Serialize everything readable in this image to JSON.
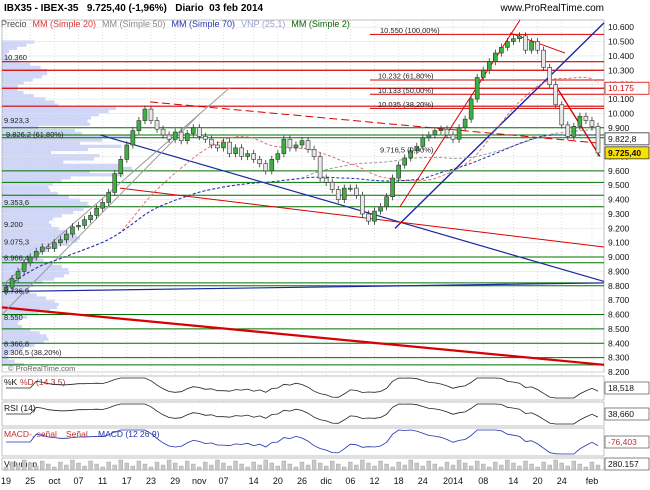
{
  "header": {
    "symbol_text": "IBX35 - IBEX-35",
    "price_text": "9.725,40 (-1,96%)",
    "period_text": "Diario",
    "date_text": "03 feb 2014",
    "site_text": "www.ProRealTime.com"
  },
  "legend": {
    "items": [
      {
        "label": "Precio",
        "color": "#555555"
      },
      {
        "label": "MM (Simple 20)",
        "color": "#e03030"
      },
      {
        "label": "MM (Simple 50)",
        "color": "#888888"
      },
      {
        "label": "MM (Simple 70)",
        "color": "#2030b0"
      },
      {
        "label": "VNP (25,1)",
        "color": "#9aa0d0"
      },
      {
        "label": "MM (Simple 2)",
        "color": "#006000"
      }
    ]
  },
  "colors": {
    "up_candle": "#3cb043",
    "down_candle": "#e8e8e8",
    "support_green": "#007000",
    "resistance_red": "#d80000",
    "trend_blue": "#1a2aa0",
    "volume_profile": "#a8b4f0",
    "price_badge": "#f8e000"
  },
  "chart_data": {
    "type": "line",
    "title": "IBX35 - IBEX-35",
    "ylim": [
      8200,
      10650
    ],
    "y_ticks": [
      8200,
      8300,
      8400,
      8500,
      8600,
      8700,
      8800,
      8900,
      9000,
      9100,
      9200,
      9300,
      9400,
      9500,
      9600,
      9700,
      9800,
      9900,
      10000,
      10100,
      10200,
      10300,
      10400,
      10500,
      10600
    ],
    "y_tick_labels": [
      "8.200",
      "8.300",
      "8.400",
      "8.500",
      "8.600",
      "8.700",
      "8.800",
      "8.900",
      "9.000",
      "9.100",
      "9.200",
      "9.300",
      "9.400",
      "9.500",
      "9.600",
      "9.700",
      "9.800",
      "9.900",
      "10.000",
      "10.100",
      "10.200",
      "10.300",
      "10.400",
      "10.500",
      "10.600"
    ],
    "x_tick_labels": [
      "19",
      "25",
      "oct",
      "07",
      "11",
      "17",
      "23",
      "29",
      "nov",
      "07",
      "14",
      "20",
      "26",
      "dic",
      "06",
      "12",
      "18",
      "24",
      "2014",
      "08",
      "14",
      "20",
      "24",
      "feb"
    ],
    "x_tick_index": [
      0,
      4,
      8,
      12,
      16,
      20,
      24,
      28,
      32,
      36,
      41,
      45,
      49,
      53,
      57,
      61,
      65,
      69,
      74,
      79,
      84,
      88,
      92,
      97
    ],
    "series": [
      {
        "values": [
          8790,
          8850,
          8900,
          8960,
          9000,
          9040,
          9070,
          9060,
          9100,
          9120,
          9160,
          9210,
          9220,
          9260,
          9290,
          9340,
          9380,
          9450,
          9580,
          9680,
          9780,
          9880,
          9950,
          10030,
          9950,
          9890,
          9850,
          9820,
          9870,
          9810,
          9860,
          9900,
          9840,
          9820,
          9780,
          9760,
          9800,
          9720,
          9760,
          9700,
          9720,
          9680,
          9650,
          9600,
          9680,
          9720,
          9820,
          9760,
          9780,
          9810,
          9750,
          9700,
          9550,
          9520,
          9470,
          9400,
          9480,
          9480,
          9430,
          9300,
          9250,
          9320,
          9350,
          9420,
          9550,
          9640,
          9690,
          9740,
          9770,
          9830,
          9850,
          9880,
          9890,
          9850,
          9820,
          9900,
          9960,
          10100,
          10250,
          10300,
          10360,
          10420,
          10460,
          10500,
          10520,
          10540,
          10440,
          10500,
          10440,
          10320,
          10200,
          10060,
          9920,
          9840,
          9910,
          9980,
          9950,
          9910,
          9725
        ]
      }
    ],
    "horizontal_levels": [
      {
        "value": 10360,
        "label": "10.360"
      },
      {
        "value": 9923.3,
        "label": "9.923,3"
      },
      {
        "value": 9353.6,
        "label": "9.353,6"
      },
      {
        "value": 9200,
        "label": "9.200"
      },
      {
        "value": 9075.3,
        "label": "9.075,3"
      },
      {
        "value": 8966.4,
        "label": "8.966,4"
      },
      {
        "value": 8736.9,
        "label": "8.736,9"
      },
      {
        "value": 8550,
        "label": "8.550"
      },
      {
        "value": 8366.8,
        "label": "8.366,8"
      },
      {
        "value": 8306.5,
        "label": "8.306,5 (38,20%)"
      }
    ],
    "fibonacci_levels": [
      {
        "value": 10550,
        "label": "10.550 (100,00%)"
      },
      {
        "value": 10232,
        "label": "10.232 (61,80%)"
      },
      {
        "value": 10133,
        "label": "10.133 (50,00%)"
      },
      {
        "value": 10035,
        "label": "10.035 (38,20%)"
      },
      {
        "value": 9716.5,
        "label": "9.716,5 (0,00%)"
      },
      {
        "value": 9826.2,
        "label": "9.826,2 (61,80%)"
      }
    ],
    "right_axis_marks": [
      {
        "value": 10175,
        "label": "10.175"
      },
      {
        "value": 9822.8,
        "label": "9.822,8"
      },
      {
        "value": 9725.4,
        "label": "9.725,40"
      }
    ],
    "indicators": {
      "stochastic": {
        "label": "%K",
        "label2": "%D (14 3 5)",
        "value_labels": [
          "18,518"
        ]
      },
      "rsi": {
        "label": "RSI (14)",
        "value_labels": [
          "38,660"
        ]
      },
      "macd": {
        "label": "MACD-, señal",
        "label2": "Señal",
        "label3": "MACD (12 26 9)",
        "value_labels": [
          "-76,403"
        ]
      },
      "volume": {
        "label": "Volumen",
        "value_labels": [
          "280.157"
        ]
      }
    },
    "watermark": "© ProRealTime.com"
  }
}
